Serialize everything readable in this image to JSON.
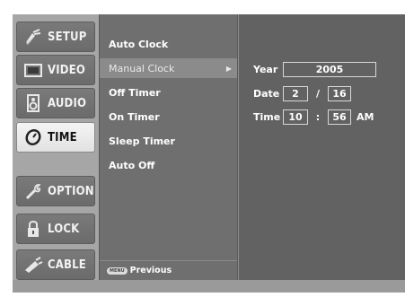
{
  "left_menu": {
    "items": [
      {
        "label": "SETUP",
        "icon": "satellite-dish-icon"
      },
      {
        "label": "VIDEO",
        "icon": "tv-screen-icon"
      },
      {
        "label": "AUDIO",
        "icon": "speaker-icon"
      },
      {
        "label": "TIME",
        "icon": "clock-icon"
      },
      {
        "label": "OPTION",
        "icon": "wrench-icon"
      },
      {
        "label": "LOCK",
        "icon": "padlock-icon"
      },
      {
        "label": "CABLE",
        "icon": "cable-plug-icon"
      }
    ],
    "active": "TIME"
  },
  "submenu": {
    "items": [
      "Auto Clock",
      "Manual Clock",
      "Off Timer",
      "On Timer",
      "Sleep Timer",
      "Auto Off"
    ],
    "selected": "Manual Clock",
    "arrow": "▶",
    "previous_key": "MENU",
    "previous_label": "Previous"
  },
  "manual_clock": {
    "year_label": "Year",
    "year": "2005",
    "date_label": "Date",
    "month": "2",
    "date_sep": "/",
    "day": "16",
    "time_label": "Time",
    "hour": "10",
    "time_sep": ":",
    "minute": "56",
    "ampm": "AM"
  },
  "colors": {
    "panel": "#626262",
    "submenu": "#6f6f6f",
    "active_tab": "#eeeeee"
  }
}
